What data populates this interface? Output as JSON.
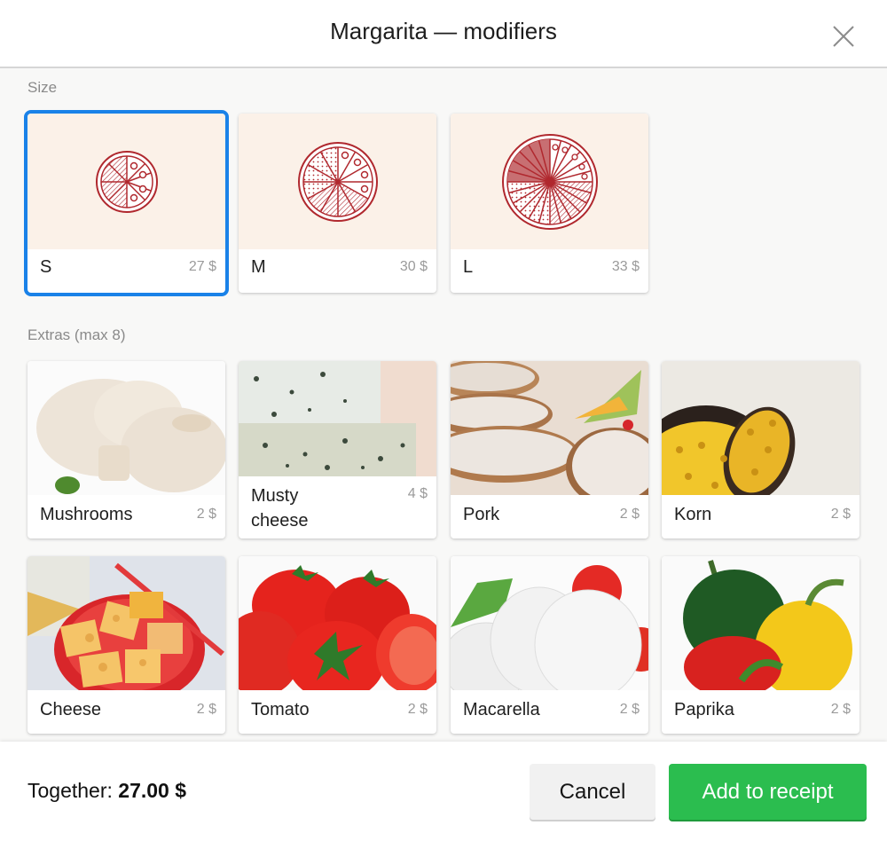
{
  "header": {
    "title": "Margarita — modifiers",
    "close_icon": "close-icon"
  },
  "size_section": {
    "label": "Size",
    "selected": "S",
    "options": [
      {
        "name": "S",
        "price": "27 $",
        "icon": "pizza-small-icon"
      },
      {
        "name": "M",
        "price": "30 $",
        "icon": "pizza-medium-icon"
      },
      {
        "name": "L",
        "price": "33 $",
        "icon": "pizza-large-icon"
      }
    ]
  },
  "extras_section": {
    "label": "Extras (max 8)",
    "items": [
      {
        "name": "Mushrooms",
        "price": "2 $",
        "image": "mushrooms-image"
      },
      {
        "name": "Musty cheese",
        "price": "4 $",
        "image": "blue-cheese-image"
      },
      {
        "name": "Pork",
        "price": "2 $",
        "image": "pork-image"
      },
      {
        "name": "Korn",
        "price": "2 $",
        "image": "corn-image"
      },
      {
        "name": "Cheese",
        "price": "2 $",
        "image": "cheese-image"
      },
      {
        "name": "Tomato",
        "price": "2 $",
        "image": "tomato-image"
      },
      {
        "name": "Macarella",
        "price": "2 $",
        "image": "mozzarella-image"
      },
      {
        "name": "Paprika",
        "price": "2 $",
        "image": "paprika-image"
      }
    ]
  },
  "footer": {
    "total_label": "Together:",
    "total_value": "27.00 $",
    "cancel_label": "Cancel",
    "add_label": "Add to receipt"
  },
  "colors": {
    "selected_border": "#1a82e8",
    "primary_button": "#2bbd4f",
    "pizza_icon": "#b0282e",
    "size_card_bg": "#fbf1e8"
  }
}
